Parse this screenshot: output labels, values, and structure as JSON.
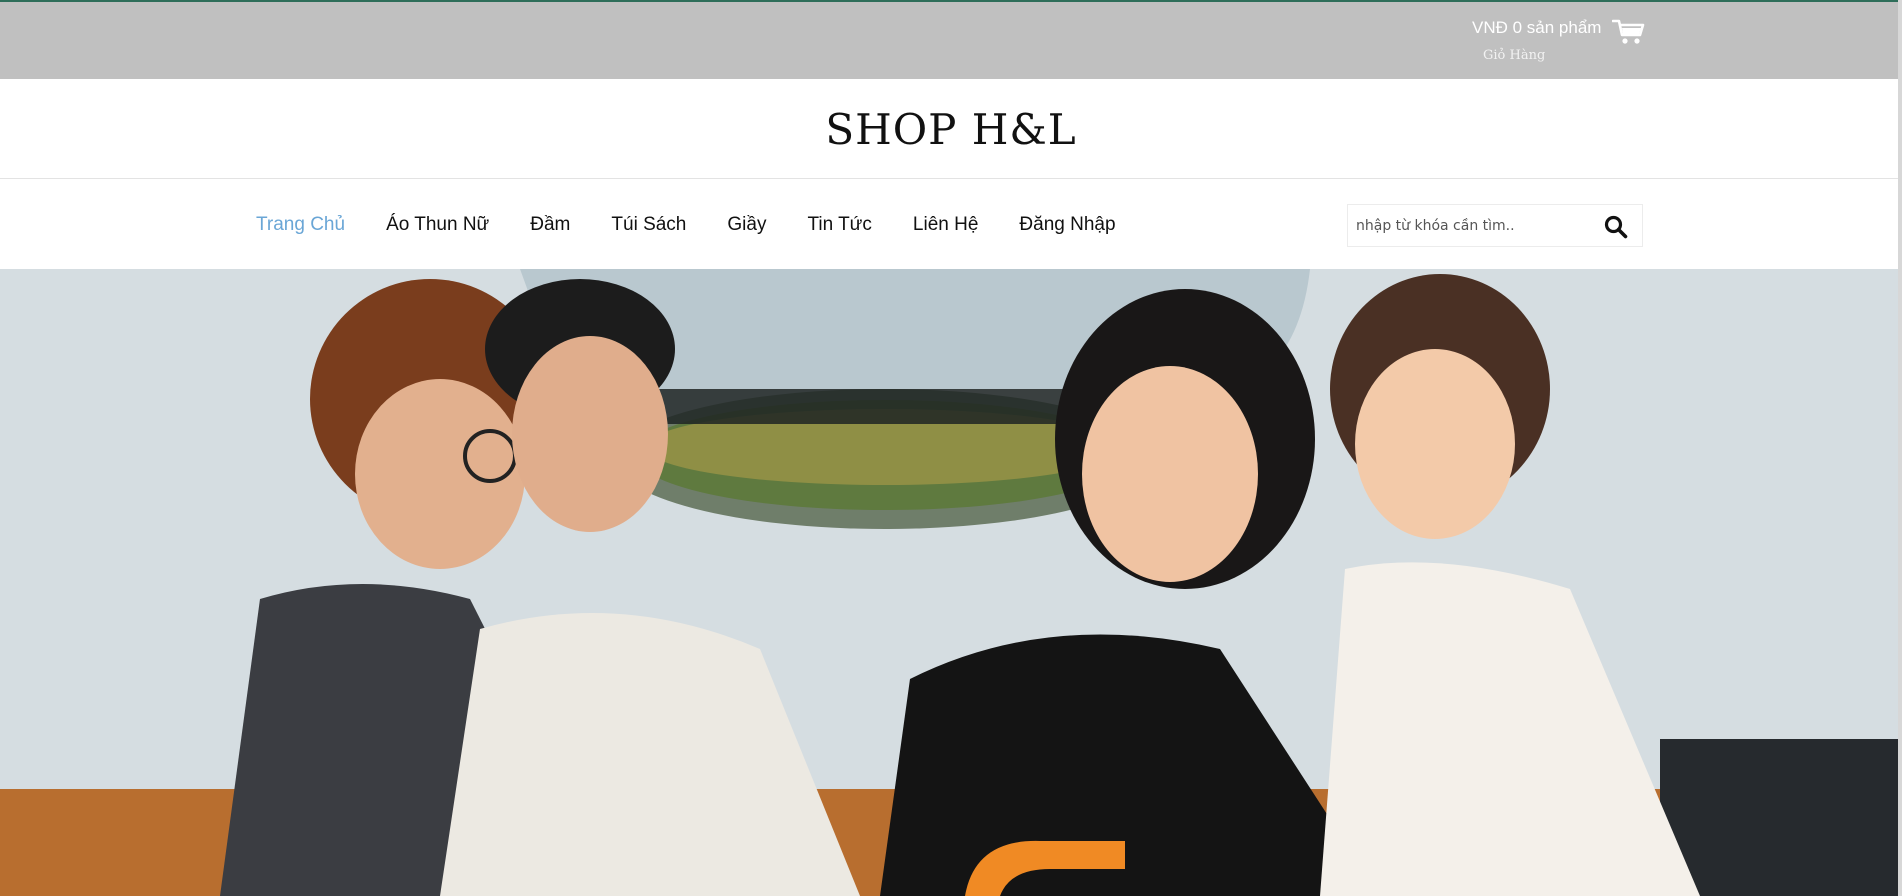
{
  "cart": {
    "summary": "VNĐ 0 sản phẩm",
    "label": "Giỏ Hàng",
    "icon": "shopping-cart-icon"
  },
  "logo": "SHOP H&L",
  "nav": {
    "items": [
      {
        "label": "Trang Chủ",
        "active": true
      },
      {
        "label": "Áo Thun Nữ"
      },
      {
        "label": "Đầm"
      },
      {
        "label": "Túi Sách"
      },
      {
        "label": "Giầy"
      },
      {
        "label": "Tin Tức"
      },
      {
        "label": "Liên Hệ"
      },
      {
        "label": "Đăng Nhập"
      }
    ],
    "active_color": "#6aa6d6"
  },
  "search": {
    "placeholder": "nhập từ khóa cần tìm..",
    "icon": "search-icon"
  },
  "colors": {
    "topbar": "#c0c0c0",
    "accent_orange": "#f08a24"
  }
}
